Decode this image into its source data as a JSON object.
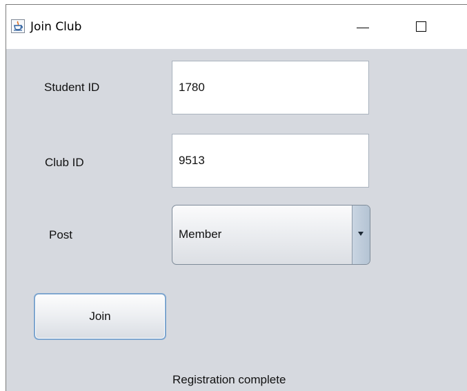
{
  "window": {
    "title": "Join Club",
    "icon": "java-cup-icon"
  },
  "form": {
    "student_id": {
      "label": "Student ID",
      "value": "1780"
    },
    "club_id": {
      "label": "Club ID",
      "value": "9513"
    },
    "post": {
      "label": "Post",
      "selected": "Member"
    },
    "join_label": "Join"
  },
  "status_text": "Registration complete",
  "colors": {
    "panel_background": "#d6d9df",
    "button_focus_border": "#7ea6cf"
  }
}
